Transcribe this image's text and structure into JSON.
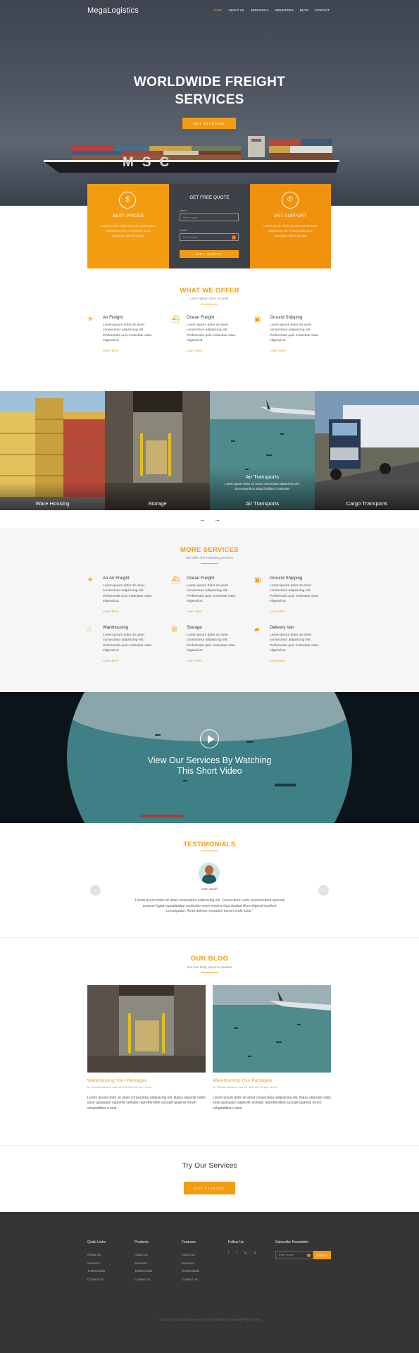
{
  "brand": "MegaLogistics",
  "nav": [
    {
      "label": "HOME",
      "active": true
    },
    {
      "label": "ABOUT US"
    },
    {
      "label": "SERVICES ▾"
    },
    {
      "label": "INDUSTRIES"
    },
    {
      "label": "BLOG"
    },
    {
      "label": "CONTACT"
    }
  ],
  "hero": {
    "title_line1": "WORLDWIDE FREIGHT",
    "title_line2": "SERVICES",
    "cta": "GET STARTED!",
    "ship_text": "MSC"
  },
  "features": {
    "best_prices": {
      "icon": "$",
      "title": "BEST PRICES",
      "text": "Lorem ipsum dolor sit amet consectetur adipisicing elit. Perspiciatis quos molestiae officia aliquid."
    },
    "quote": {
      "title": "GET FREE QUOTE",
      "name_label": "Name",
      "name_placeholder": "Enter name",
      "email_label": "Email",
      "email_placeholder": "Enter email",
      "button": "GET QUOTE"
    },
    "support": {
      "icon": "✆",
      "title": "24/7 SUPPORT",
      "text": "Lorem ipsum dolor sit amet consectetur adipisicing elit. Perspiciatis quos molestiae officia aliquid."
    }
  },
  "offer": {
    "title": "WHAT WE OFFER",
    "subtitle": "Lorem ipsum dolor sit amet.",
    "items": [
      {
        "title": "Air Freight",
        "text": "Lorem ipsum dolor sit amet consectetur adipisicing elit. Perferendis quis molestiae vitae eligendi at.",
        "link": "Learn More"
      },
      {
        "title": "Ocean Freight",
        "text": "Lorem ipsum dolor sit amet consectetur adipisicing elit. Perferendis quis molestiae vitae eligendi at.",
        "link": "Learn More"
      },
      {
        "title": "Ground Shipping",
        "text": "Lorem ipsum dolor sit amet consectetur adipisicing elit. Perferendis quis molestiae vitae eligendi at.",
        "link": "Learn More"
      }
    ]
  },
  "gallery": [
    {
      "label": "Ware Housing"
    },
    {
      "label": "Storage"
    },
    {
      "label": "Air Transports",
      "overlay_title": "Air Transports",
      "overlay_text": "Lorem ipsum dolor sit amet consectetur adipisicing elit. Ea temporibus aliquid adipisci molestias"
    },
    {
      "label": "Cargo Transports"
    }
  ],
  "gallery_arrows": {
    "prev": "←",
    "next": "→"
  },
  "more": {
    "title": "MORE SERVICES",
    "subtitle": "We Offer The Following Services",
    "items": [
      {
        "title": "Air Air Freight",
        "text": "Lorem ipsum dolor sit amet consectetur adipisicing elit. Perferendis quis molestiae vitae eligendi at.",
        "link": "Learn More"
      },
      {
        "title": "Ocean Freight",
        "text": "Lorem ipsum dolor sit amet consectetur adipisicing elit. Perferendis quis molestiae vitae eligendi at.",
        "link": "Learn More"
      },
      {
        "title": "Ground Shipping",
        "text": "Lorem ipsum dolor sit amet consectetur adipisicing elit. Perferendis quis molestiae vitae eligendi at.",
        "link": "Learn More"
      },
      {
        "title": "Warehousing",
        "text": "Lorem ipsum dolor sit amet consectetur adipisicing elit. Perferendis quis molestiae vitae eligendi at.",
        "link": "Learn More"
      },
      {
        "title": "Storage",
        "text": "Lorem ipsum dolor sit amet consectetur adipisicing elit. Perferendis quis molestiae vitae eligendi at.",
        "link": "Learn More"
      },
      {
        "title": "Delivery Van",
        "text": "Lorem ipsum dolor sit amet consectetur adipisicing elit. Perferendis quis molestiae vitae eligendi at.",
        "link": "Learn More"
      }
    ]
  },
  "video": {
    "line1": "View Our Services By Watching",
    "line2": "This Short Video"
  },
  "testimonials": {
    "title": "TESTIMONIALS",
    "name": "John Smith",
    "quote_line1": "“Lorem ipsum dolor sit amet consectetur adipisicing elit. Consectetur unde reprehenderit aperiam",
    "quote_line2": "quaerat fugiat repudiandae explicabo animi minima fuga beatae illum eligendi incidunt",
    "quote_line3": "consequatur. Amet dolores excepturi earum unde iusto.”",
    "prev": "‹",
    "next": "›"
  },
  "blog": {
    "title": "OUR BLOG",
    "subtitle": "See Our Daily News & Updates",
    "posts": [
      {
        "title": "Warehousing Your Packages",
        "meta_by": "by Theresa Winston",
        "meta_date": "Jan 18, 2019 at 2:00 pm",
        "meta_tag": "News",
        "text": "Lorem ipsum dolor sit amet consectetur adipisicing elit. Natus eligendi nobis esse quisquam sapiente veritatis reprehenderit suscipit quaerat rerum voluptatibus a eius."
      },
      {
        "title": "Warehousing Your Packages",
        "meta_by": "by Theresa Winston",
        "meta_date": "Jan 18, 2019 at 2:00 pm",
        "meta_tag": "News",
        "text": "Lorem ipsum dolor sit amet consectetur adipisicing elit. Natus eligendi nobis esse quisquam sapiente veritatis reprehenderit suscipit quaerat rerum voluptatibus a eius."
      }
    ]
  },
  "try": {
    "title": "Try Our Services",
    "button": "GET STARTED"
  },
  "footer": {
    "cols": [
      {
        "title": "Quick Links",
        "links": [
          "About Us",
          "Services",
          "Testimonials",
          "Contact Us"
        ]
      },
      {
        "title": "Products",
        "links": [
          "About Us",
          "Services",
          "Testimonials",
          "Contact Us"
        ]
      },
      {
        "title": "Features",
        "links": [
          "About Us",
          "Services",
          "Testimonials",
          "Contact Us"
        ]
      }
    ],
    "follow": {
      "title": "Follow Us",
      "icons": [
        "f",
        "t",
        "◎",
        "in"
      ]
    },
    "subscribe": {
      "title": "Subscribe Newsletter",
      "placeholder": "Enter Email",
      "button": "SEND"
    },
    "copyright": "Copyright ©2023 All rights reserved | This template is made with ❤ by Colorlib"
  },
  "colors": {
    "accent": "#f39c12",
    "dark": "#3e4147",
    "footer": "#353535"
  }
}
